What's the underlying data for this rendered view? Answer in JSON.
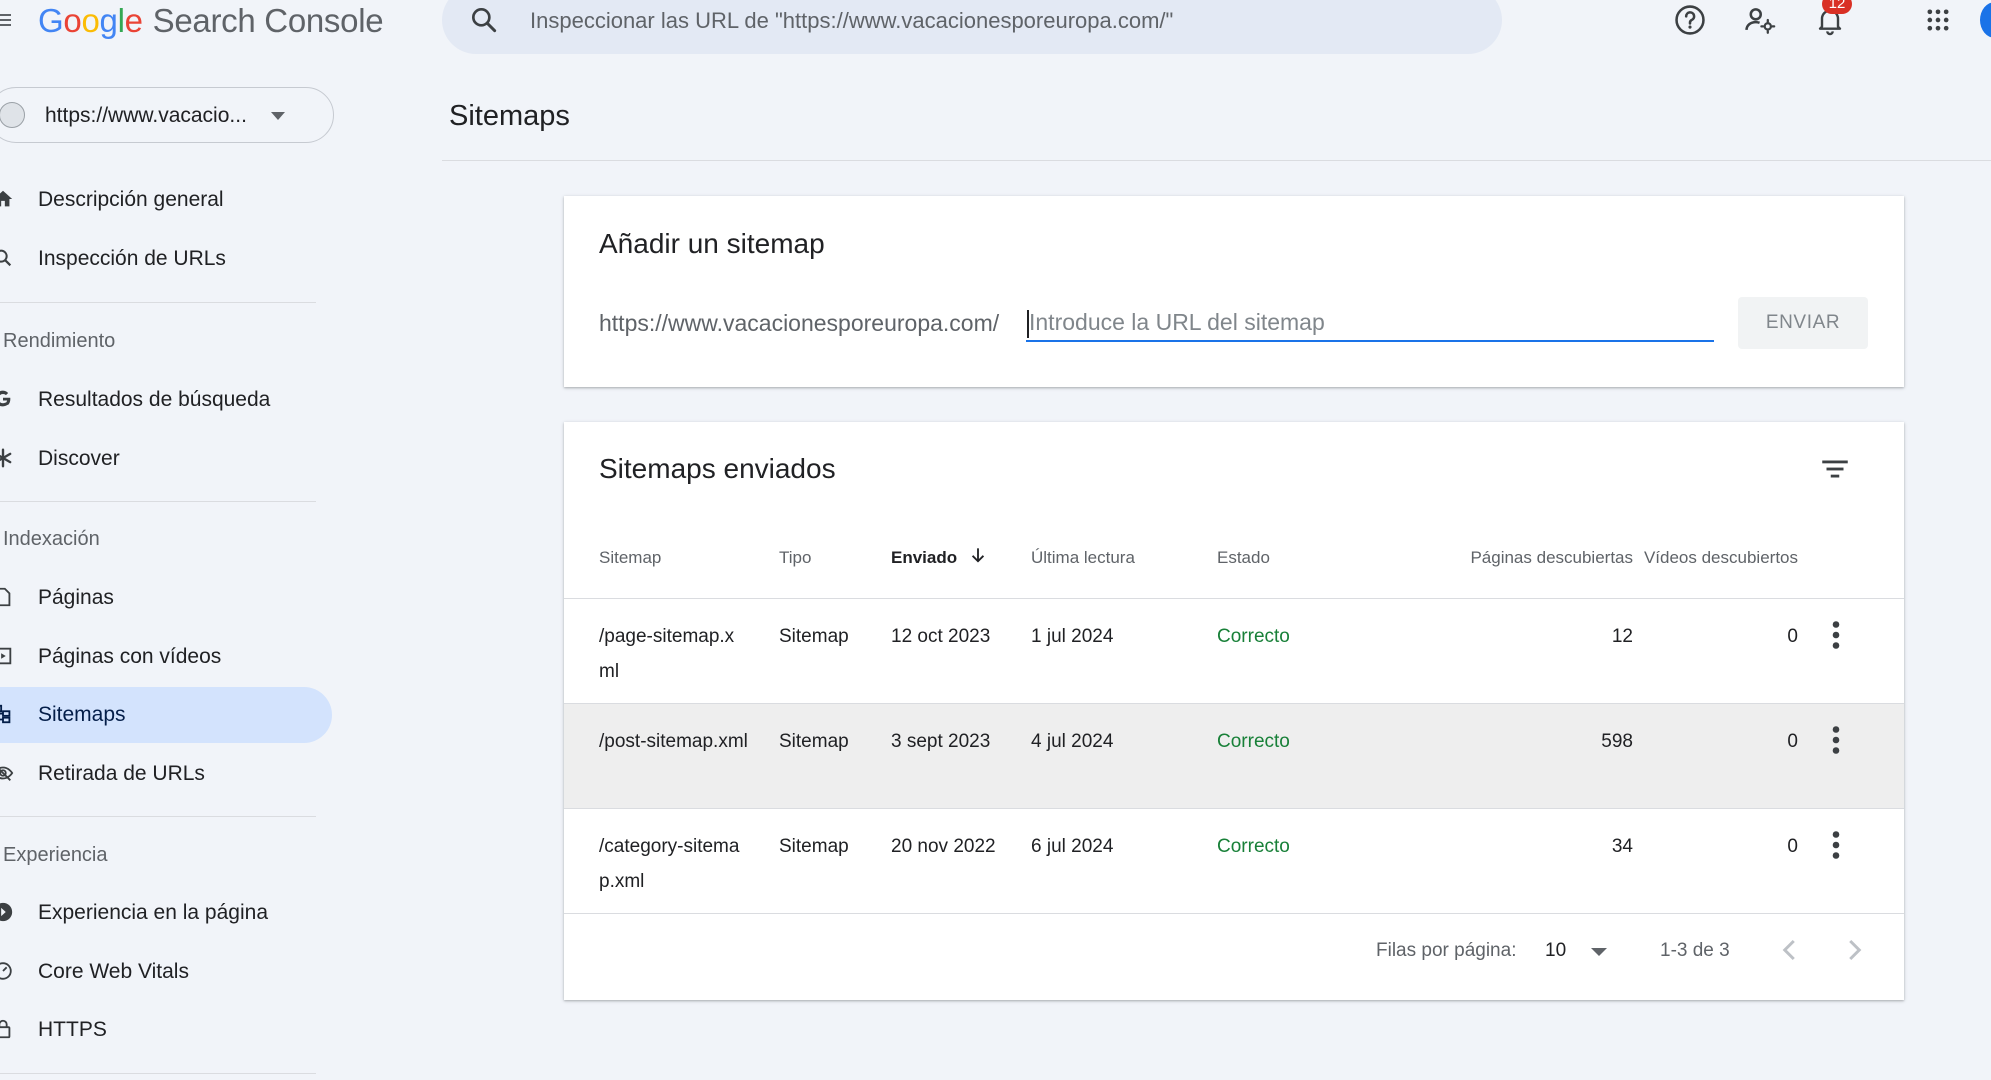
{
  "header": {
    "logo_letters": [
      "G",
      "o",
      "o",
      "g",
      "l",
      "e"
    ],
    "product": "Search Console",
    "search_placeholder": "Inspeccionar las URL de \"https://www.vacacionesporeuropa.com/\"",
    "notifications_count": "12",
    "icons": [
      "menu-icon",
      "search-icon",
      "help-icon",
      "manage-users-icon",
      "notifications-icon",
      "apps-icon"
    ]
  },
  "sidebar": {
    "property": "https://www.vacacio...",
    "items_top": [
      {
        "label": "Descripción general",
        "icon": "home-icon"
      },
      {
        "label": "Inspección de URLs",
        "icon": "search-icon"
      }
    ],
    "sections": [
      {
        "title": "Rendimiento",
        "items": [
          {
            "label": "Resultados de búsqueda",
            "icon": "google-g-icon"
          },
          {
            "label": "Discover",
            "icon": "asterisk-icon"
          }
        ]
      },
      {
        "title": "Indexación",
        "items": [
          {
            "label": "Páginas",
            "icon": "pages-icon"
          },
          {
            "label": "Páginas con vídeos",
            "icon": "video-pages-icon"
          },
          {
            "label": "Sitemaps",
            "icon": "sitemap-icon",
            "active": true
          },
          {
            "label": "Retirada de URLs",
            "icon": "removal-icon"
          }
        ]
      },
      {
        "title": "Experiencia",
        "items": [
          {
            "label": "Experiencia en la página",
            "icon": "page-experience-icon"
          },
          {
            "label": "Core Web Vitals",
            "icon": "gauge-icon"
          },
          {
            "label": "HTTPS",
            "icon": "lock-icon"
          }
        ]
      }
    ]
  },
  "main": {
    "title": "Sitemaps",
    "add_card": {
      "title": "Añadir un sitemap",
      "prefix": "https://www.vacacionesporeuropa.com/",
      "input_placeholder": "Introduce la URL del sitemap",
      "input_value": "",
      "submit_label": "ENVIAR"
    },
    "list_card": {
      "title": "Sitemaps enviados",
      "columns": [
        "Sitemap",
        "Tipo",
        "Enviado",
        "Última lectura",
        "Estado",
        "Páginas descubiertas",
        "Vídeos descubiertos"
      ],
      "sorted_column": "Enviado",
      "rows": [
        {
          "sitemap": "/page-sitemap.xml",
          "tipo": "Sitemap",
          "enviado": "12 oct 2023",
          "lectura": "1 jul 2024",
          "estado": "Correcto",
          "paginas": "12",
          "videos": "0"
        },
        {
          "sitemap": "/post-sitemap.xml",
          "tipo": "Sitemap",
          "enviado": "3 sept 2023",
          "lectura": "4 jul 2024",
          "estado": "Correcto",
          "paginas": "598",
          "videos": "0"
        },
        {
          "sitemap": "/category-sitemap.xml",
          "tipo": "Sitemap",
          "enviado": "20 nov 2022",
          "lectura": "6 jul 2024",
          "estado": "Correcto",
          "paginas": "34",
          "videos": "0"
        }
      ],
      "footer": {
        "rows_per_page_label": "Filas por página:",
        "rows_per_page_value": "10",
        "range": "1-3 de 3"
      }
    }
  },
  "colors": {
    "background": "#f1f4f9",
    "active_nav": "#d3e3fd",
    "accent": "#1a73e8",
    "status_ok": "#188038",
    "badge": "#d93025"
  }
}
